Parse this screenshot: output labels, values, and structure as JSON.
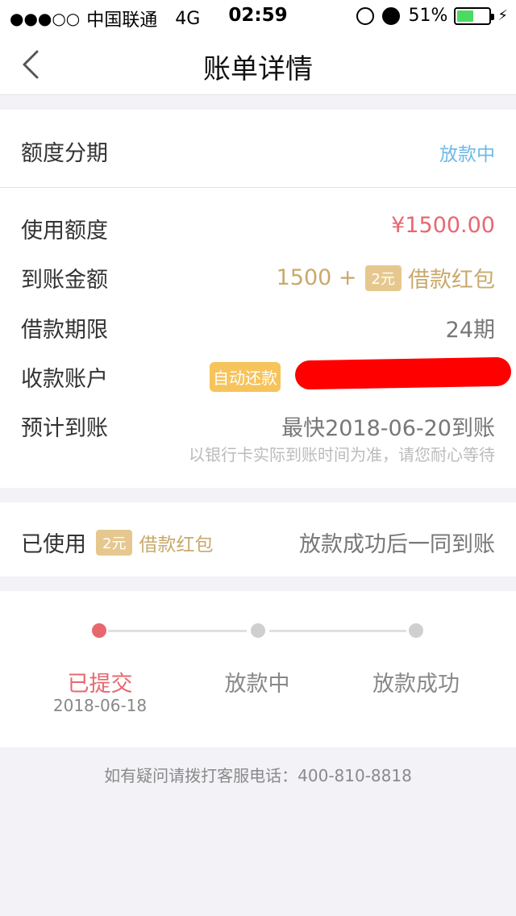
{
  "status_bar": {
    "signal": "●●●○○",
    "carrier": "中国联通",
    "network": "4G",
    "time": "02:59",
    "battery_percent": "51%",
    "battery_level": 0.51,
    "icons": [
      "rotation-lock-icon",
      "alarm-icon",
      "battery-icon",
      "charging-bolt-icon"
    ]
  },
  "nav": {
    "title": "账单详情",
    "back_icon": "chevron-left-icon"
  },
  "summary": {
    "label": "额度分期",
    "status": "放款中"
  },
  "details": {
    "amount_label": "使用额度",
    "amount_value": "¥1500.00",
    "received_label": "到账金额",
    "received_value": "1500 +",
    "received_tag": "2元",
    "received_suffix": "借款红包",
    "term_label": "借款期限",
    "term_value": "24期",
    "account_label": "收款账户",
    "account_tag": "自动还款",
    "eta_label": "预计到账",
    "eta_value": "最快2018-06-20到账",
    "eta_note": "以银行卡实际到账时间为准，请您耐心等待"
  },
  "coupon": {
    "label": "已使用",
    "tag": "2元",
    "name": "借款红包",
    "note": "放款成功后一同到账"
  },
  "progress": {
    "steps": [
      {
        "label": "已提交",
        "date": "2018-06-18",
        "active": true
      },
      {
        "label": "放款中",
        "date": "",
        "active": false
      },
      {
        "label": "放款成功",
        "date": "",
        "active": false
      }
    ]
  },
  "footer": {
    "hotline": "如有疑问请拨打客服电话：400-810-8818"
  },
  "colors": {
    "accent_red": "#e8676f",
    "gold": "#c9a96b",
    "status_blue": "#6fb9e6",
    "gray_text": "#777777"
  }
}
